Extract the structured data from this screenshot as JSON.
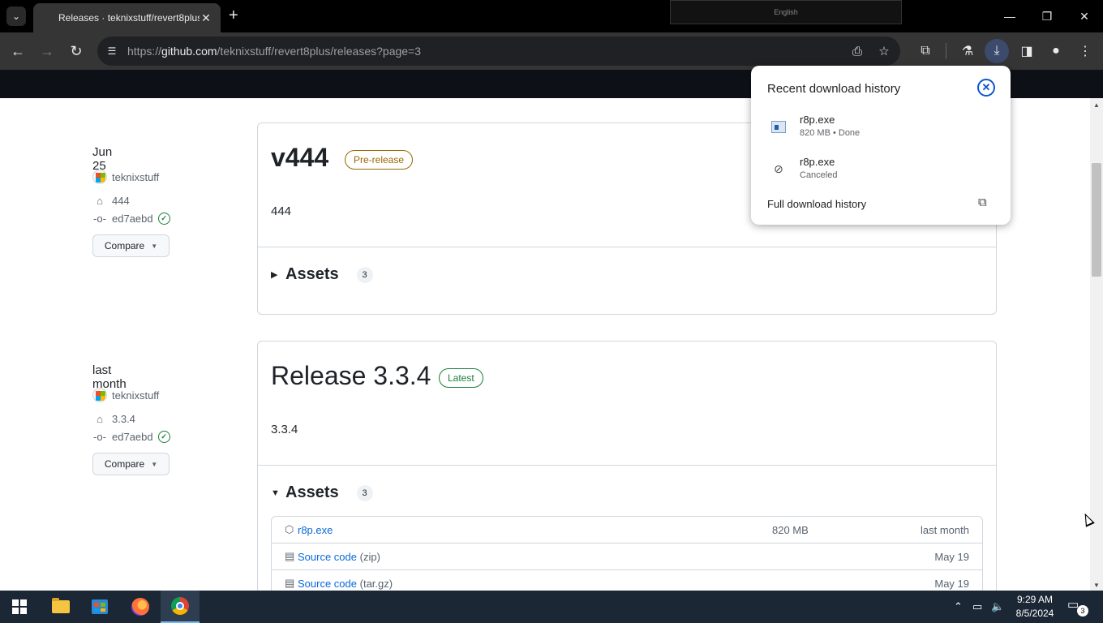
{
  "browser": {
    "tab_title": "Releases · teknixstuff/revert8plus",
    "tab_close": "✕",
    "new_tab": "+",
    "url_prefix": "https://",
    "url_domain": "github.com",
    "url_path": "/teknixstuff/revert8plus/releases?page=3",
    "language_label": "English",
    "icons": [
      "tab-search-icon",
      "back-icon",
      "forward-icon",
      "reload-icon",
      "site-info-icon",
      "install-app-icon",
      "bookmark-star-icon",
      "extensions-icon",
      "labs-icon",
      "downloads-icon",
      "side-panel-icon",
      "profile-icon",
      "menu-icon"
    ]
  },
  "releases": [
    {
      "date": "Jun 25",
      "author": "teknixstuff",
      "tag": "444",
      "commit": "ed7aebd",
      "compare_label": "Compare",
      "title": "v444",
      "badge": "Pre-release",
      "body": "444",
      "assets_label": "Assets",
      "assets_count": "3",
      "assets_expanded": false
    },
    {
      "date": "last month",
      "author": "teknixstuff",
      "tag": "3.3.4",
      "commit": "ed7aebd",
      "compare_label": "Compare",
      "title": "Release 3.3.4",
      "badge": "Latest",
      "body": "3.3.4",
      "assets_label": "Assets",
      "assets_count": "3",
      "assets_expanded": true,
      "assets": [
        {
          "name": "r8p.exe",
          "ext": "",
          "size": "820 MB",
          "date": "last month"
        },
        {
          "name": "Source code",
          "ext": "(zip)",
          "size": "",
          "date": "May 19"
        },
        {
          "name": "Source code",
          "ext": "(tar.gz)",
          "size": "",
          "date": "May 19"
        }
      ]
    }
  ],
  "downloads_popup": {
    "title": "Recent download history",
    "items": [
      {
        "name": "r8p.exe",
        "status": "820 MB • Done"
      },
      {
        "name": "r8p.exe",
        "status": "Canceled"
      }
    ],
    "full_history_label": "Full download history"
  },
  "taskbar": {
    "time": "9:29 AM",
    "date": "8/5/2024",
    "notification_count": "3"
  },
  "colors": {
    "link": "#0969da",
    "prerelease": "#9a6700",
    "latest": "#1a7f37",
    "accent": "#0b57d0"
  }
}
